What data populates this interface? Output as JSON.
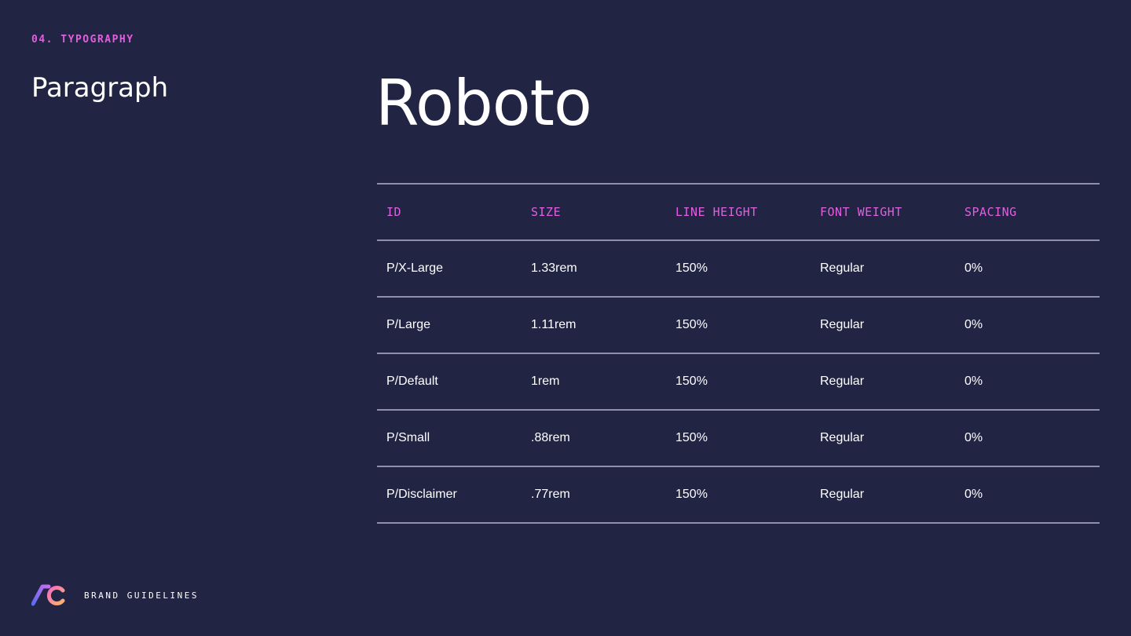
{
  "header": {
    "section_label": "04. TYPOGRAPHY",
    "subtitle": "Paragraph",
    "font_name": "Roboto"
  },
  "table": {
    "columns": [
      "ID",
      "SIZE",
      "LINE HEIGHT",
      "FONT WEIGHT",
      "SPACING"
    ],
    "rows": [
      [
        "P/X-Large",
        "1.33rem",
        "150%",
        "Regular",
        "0%"
      ],
      [
        "P/Large",
        "1.11rem",
        "150%",
        "Regular",
        "0%"
      ],
      [
        "P/Default",
        "1rem",
        "150%",
        "Regular",
        "0%"
      ],
      [
        "P/Small",
        ".88rem",
        "150%",
        "Regular",
        "0%"
      ],
      [
        "P/Disclaimer",
        ".77rem",
        "150%",
        "Regular",
        "0%"
      ]
    ]
  },
  "footer": {
    "brand_text": "BRAND GUIDELINES",
    "logo_icon": "ac-logo-icon"
  },
  "colors": {
    "background": "#222443",
    "accent": "#e25ee0",
    "divider": "#8e90ab",
    "text": "#ffffff"
  }
}
